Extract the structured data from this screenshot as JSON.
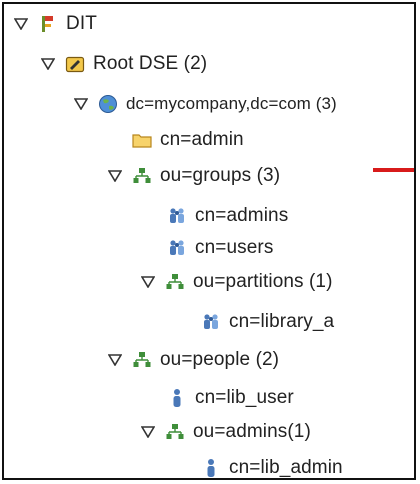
{
  "tree": {
    "dit": {
      "label": "DIT",
      "expanded": true,
      "icon": "dit-root-icon"
    },
    "root_dse": {
      "label": "Root DSE (2)",
      "expanded": true,
      "icon": "root-dse-icon"
    },
    "domain": {
      "label": "dc=mycompany,dc=com (3)",
      "expanded": true,
      "icon": "globe-icon"
    },
    "admin": {
      "label": "cn=admin",
      "icon": "folder-icon"
    },
    "groups": {
      "label": "ou=groups (3)",
      "expanded": true,
      "icon": "org-unit-icon"
    },
    "admins_group": {
      "label": "cn=admins",
      "icon": "group-icon"
    },
    "users_group": {
      "label": "cn=users",
      "icon": "group-icon"
    },
    "partitions": {
      "label": "ou=partitions (1)",
      "expanded": true,
      "icon": "org-unit-icon"
    },
    "library_a": {
      "label": "cn=library_a",
      "icon": "group-icon"
    },
    "people": {
      "label": "ou=people (2)",
      "expanded": true,
      "icon": "org-unit-icon"
    },
    "lib_user": {
      "label": "cn=lib_user",
      "icon": "person-icon"
    },
    "admins_ou": {
      "label": "ou=admins(1)",
      "expanded": true,
      "icon": "org-unit-icon"
    },
    "lib_admin": {
      "label": "cn=lib_admin",
      "icon": "person-icon"
    }
  },
  "colors": {
    "marker": "#d81b1b",
    "ou_icon": "#3f8e3a",
    "group_icon": "#4a78b8",
    "folder_icon": "#e8b33a"
  }
}
